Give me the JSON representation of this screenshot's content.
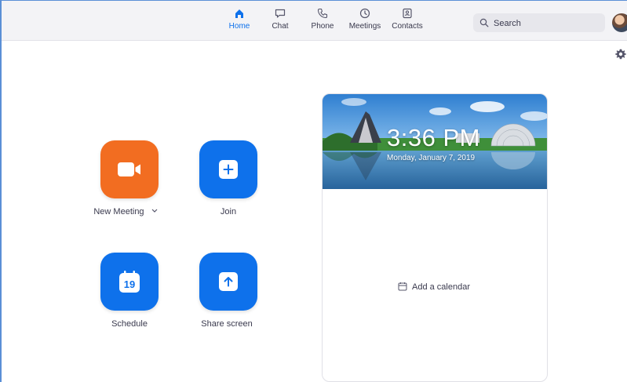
{
  "nav": {
    "tabs": [
      {
        "label": "Home",
        "icon": "home-icon",
        "active": true
      },
      {
        "label": "Chat",
        "icon": "chat-icon",
        "active": false
      },
      {
        "label": "Phone",
        "icon": "phone-icon",
        "active": false
      },
      {
        "label": "Meetings",
        "icon": "clock-icon",
        "active": false
      },
      {
        "label": "Contacts",
        "icon": "contact-card-icon",
        "active": false
      }
    ],
    "search": {
      "placeholder": "Search",
      "value": ""
    },
    "accent_color": "#0e71eb"
  },
  "actions": {
    "new_meeting": {
      "label": "New Meeting",
      "icon": "video-camera-icon",
      "color": "#f26d21"
    },
    "join": {
      "label": "Join",
      "icon": "plus-icon",
      "color": "#0e71eb"
    },
    "schedule": {
      "label": "Schedule",
      "icon": "calendar-icon",
      "day": "19",
      "color": "#0e71eb"
    },
    "share_screen": {
      "label": "Share screen",
      "icon": "upload-arrow-icon",
      "color": "#0e71eb"
    }
  },
  "calendar_card": {
    "time": "3:36 PM",
    "date": "Monday, January 7, 2019",
    "add_calendar_label": "Add a calendar"
  }
}
